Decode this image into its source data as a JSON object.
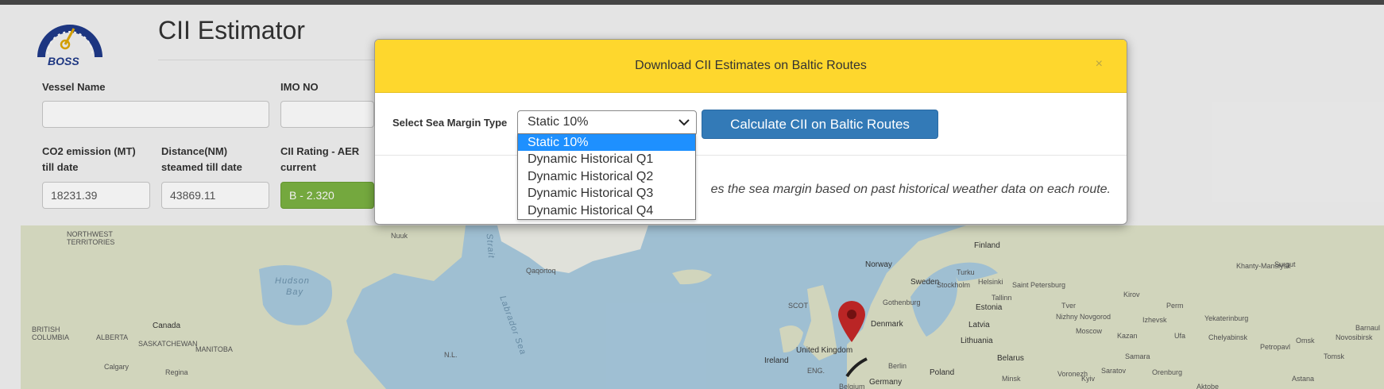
{
  "app": {
    "logo_text": "BOSS",
    "title": "CII Estimator"
  },
  "form": {
    "vessel_name_label": "Vessel Name",
    "vessel_name_value": "",
    "imo_label": "IMO NO",
    "imo_value": "",
    "co2_label_line1": "CO2 emission (MT)",
    "co2_label_line2": "till date",
    "co2_value": "18231.39",
    "distance_label_line1": "Distance(NM)",
    "distance_label_line2": "steamed till date",
    "distance_value": "43869.11",
    "cii_label_line1": "CII Rating - AER",
    "cii_label_line2": "current",
    "cii_value": "B - 2.320",
    "cii_color": "#7cb342"
  },
  "map": {
    "labels": [
      "NORTHWEST",
      "TERRITORIES",
      "Hudson",
      "Bay",
      "Labrador Sea",
      "Strait",
      "Nuuk",
      "Qaqortoq",
      "Canada",
      "BRITISH",
      "COLUMBIA",
      "ALBERTA",
      "SASKATCHEWAN",
      "MANITOBA",
      "Calgary",
      "Regina",
      "N.L.",
      "Finland",
      "Norway",
      "Sweden",
      "Stockholm",
      "Turku",
      "Helsinki",
      "Saint Petersburg",
      "Estonia",
      "Tallinn",
      "Latvia",
      "Lithuania",
      "Denmark",
      "Gothenburg",
      "United Kingdom",
      "SCOT",
      "ENG.",
      "Ireland",
      "Poland",
      "Berlin",
      "Germany",
      "Belarus",
      "Minsk",
      "Belgium",
      "Kyiv",
      "Perm",
      "Ufa",
      "Yekaterinburg",
      "Chelyabinsk",
      "Omsk",
      "Novosibirsk",
      "Khanty-Mansiysk",
      "Surgut",
      "Kirov",
      "Kazan",
      "Nizhny Novgorod",
      "Samara",
      "Orenburg",
      "Voronezh",
      "Saratov",
      "Astana",
      "Tver",
      "Izhevsk",
      "Petropavl",
      "Barnaul",
      "Tomsk",
      "Aktobe",
      "Moscow"
    ],
    "marker_color": "#c62828"
  },
  "modal": {
    "title": "Download CII Estimates on Baltic Routes",
    "close_glyph": "×",
    "header_color": "#fed72d",
    "sea_margin_label": "Select Sea Margin Type",
    "selected_option": "Static 10%",
    "options": [
      "Static 10%",
      "Dynamic Historical Q1",
      "Dynamic Historical Q2",
      "Dynamic Historical Q3",
      "Dynamic Historical Q4"
    ],
    "calculate_button": "Calculate CII on Baltic Routes",
    "note": "es the sea margin based on past historical weather data on each route."
  },
  "icons": {
    "logo": "speedometer-logo-icon",
    "chevron": "chevron-down-icon",
    "marker": "map-pin-icon"
  }
}
